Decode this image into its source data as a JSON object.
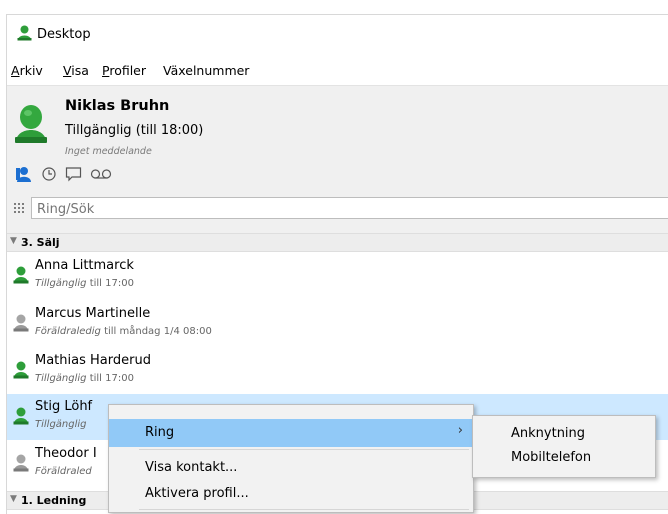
{
  "window": {
    "title": "Desktop"
  },
  "menubar": {
    "items": [
      {
        "accel": "A",
        "rest": "rkiv"
      },
      {
        "accel": "V",
        "rest": "isa"
      },
      {
        "accel": "P",
        "rest": "rofiler"
      },
      {
        "accel": "",
        "rest": "Växelnummer"
      }
    ]
  },
  "profile": {
    "name": "Niklas Bruhn",
    "status": "Tillgänglig (till 18:00)",
    "message": "Inget meddelande"
  },
  "search": {
    "placeholder": "Ring/Sök"
  },
  "groups": [
    {
      "label": "3. Sälj"
    },
    {
      "label": "1. Ledning"
    }
  ],
  "contacts": [
    {
      "name": "Anna Littmarck",
      "status": "Tillgänglig",
      "detail": " till 17:00"
    },
    {
      "name": "Marcus Martinelle",
      "status": "Föräldraledig",
      "detail": " till måndag 1/4 08:00"
    },
    {
      "name": "Mathias Harderud",
      "status": "Tillgänglig",
      "detail": " till 17:00"
    },
    {
      "name": "Stig Löhf",
      "status": "Tillgänglig",
      "detail": ""
    },
    {
      "name": "Theodor I",
      "status": "Föräldraled",
      "detail": ""
    }
  ],
  "context_menu": {
    "items": [
      {
        "label": "Ring",
        "submenu_arrow": "›"
      },
      {
        "label": "Visa kontakt..."
      },
      {
        "label": "Aktivera profil..."
      }
    ]
  },
  "submenu": {
    "items": [
      {
        "label": "Anknytning"
      },
      {
        "label": "Mobiltelefon"
      }
    ]
  },
  "colors": {
    "available": "#2e9e3a",
    "away": "#9a9a9a",
    "selection": "#cde8ff",
    "menu_highlight": "#91c9f7",
    "tool_blue": "#1c6fd1"
  }
}
